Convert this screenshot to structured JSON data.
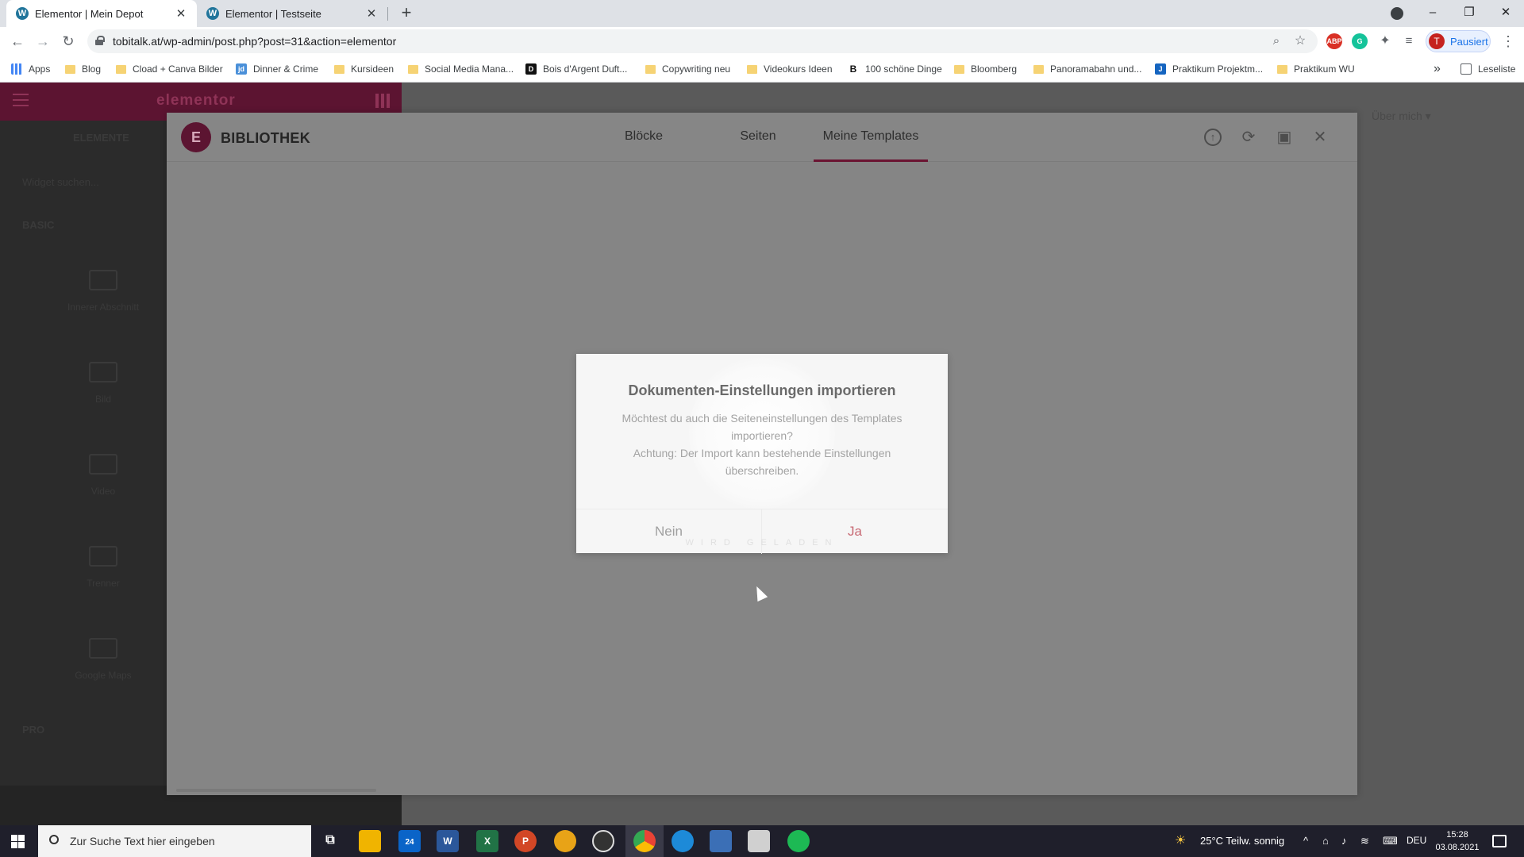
{
  "browser": {
    "tabs": [
      {
        "title": "Elementor | Mein Depot",
        "active": true
      },
      {
        "title": "Elementor | Testseite",
        "active": false
      }
    ],
    "url": "tobitalk.at/wp-admin/post.php?post=31&action=elementor",
    "profile_button": "Pausiert",
    "profile_initial": "T",
    "bookmarks": [
      {
        "label": "Apps",
        "icon": "apps-grid-icon"
      },
      {
        "label": "Blog",
        "icon": "folder-icon"
      },
      {
        "label": "Cload + Canva Bilder",
        "icon": "folder-icon"
      },
      {
        "label": "Dinner & Crime",
        "icon": "site-icon"
      },
      {
        "label": "Kursideen",
        "icon": "folder-icon"
      },
      {
        "label": "Social Media Mana...",
        "icon": "folder-icon"
      },
      {
        "label": "Bois d'Argent Duft...",
        "icon": "site-icon"
      },
      {
        "label": "Copywriting neu",
        "icon": "folder-icon"
      },
      {
        "label": "Videokurs Ideen",
        "icon": "folder-icon"
      },
      {
        "label": "100 schöne Dinge",
        "icon": "site-icon"
      },
      {
        "label": "Bloomberg",
        "icon": "folder-icon"
      },
      {
        "label": "Panoramabahn und...",
        "icon": "folder-icon"
      },
      {
        "label": "Praktikum Projektm...",
        "icon": "site-icon"
      },
      {
        "label": "Praktikum WU",
        "icon": "folder-icon"
      }
    ],
    "reading_list": "Leseliste",
    "more_bookmarks": "»"
  },
  "editor": {
    "panel_logo": "elementor",
    "panel_tab": "ELEMENTE",
    "panel_search": "Widget suchen...",
    "panel_section": "BASIC",
    "widgets": [
      "Innerer Abschnitt",
      "Bild",
      "Video",
      "Trenner",
      "Google Maps"
    ],
    "panel_section_2": "PRO",
    "right_hint": "Über mich ▾"
  },
  "library": {
    "title": "BIBLIOTHEK",
    "logo_letter": "E",
    "tabs": [
      "Blöcke",
      "Seiten",
      "Meine Templates"
    ],
    "active_tab": "Meine Templates",
    "actions": [
      "upload-icon",
      "sync-icon",
      "save-icon",
      "close-icon"
    ]
  },
  "dialog": {
    "title": "Dokumenten-Einstellungen importieren",
    "message_1": "Möchtest du auch die Seiteneinstellungen des Templates importieren?",
    "message_2": "Achtung: Der Import kann bestehende Einstellungen überschreiben.",
    "cancel": "Nein",
    "confirm": "Ja",
    "loading": "WIRD GELADEN"
  },
  "taskbar": {
    "search_placeholder": "Zur Suche Text hier eingeben",
    "mail_badge": "24",
    "weather": "25°C  Teilw. sonnig",
    "language": "DEU",
    "time": "15:28",
    "date": "03.08.2021"
  },
  "colors": {
    "elementor_brand": "#92003b",
    "accent_confirm": "#c86a74"
  }
}
